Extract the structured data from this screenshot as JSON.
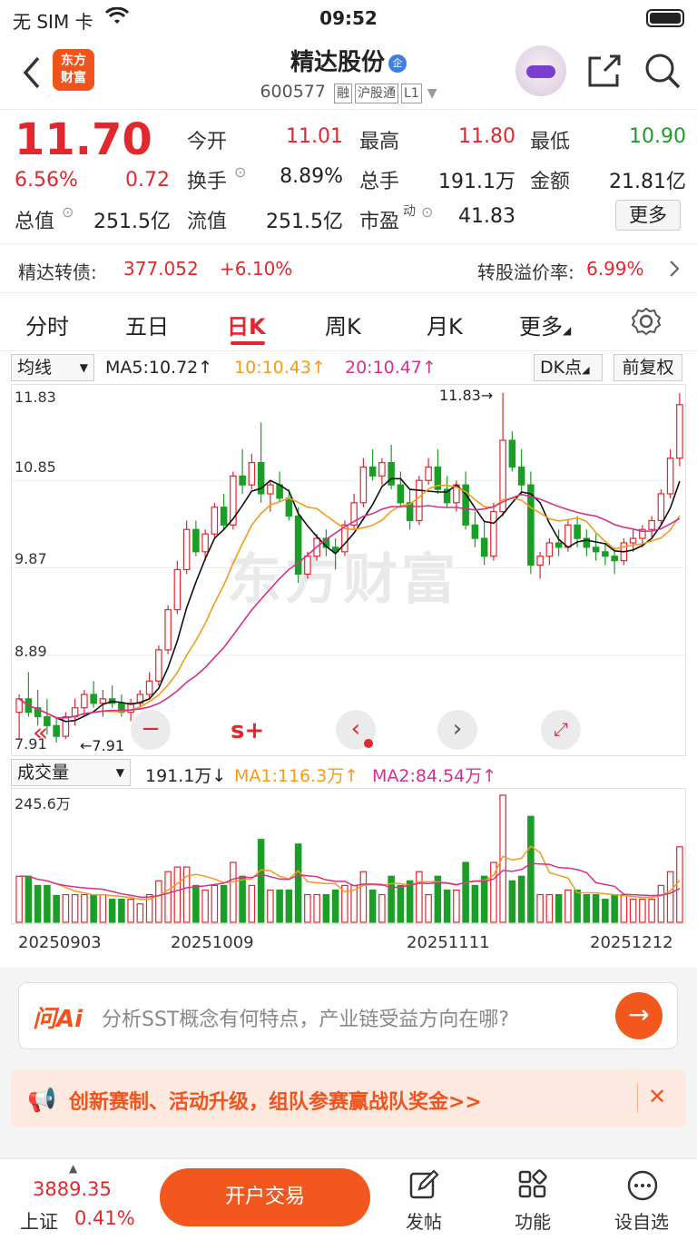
{
  "status_bar": {
    "carrier": "无 SIM 卡",
    "time": "09:52"
  },
  "header": {
    "logo_line1": "东方",
    "logo_line2": "财富",
    "stock_name": "精达股份",
    "badge": "企",
    "code": "600577",
    "tags": [
      "融",
      "沪股通",
      "L1"
    ]
  },
  "quote": {
    "price": "11.70",
    "change_pct": "6.56%",
    "change": "0.72",
    "open_label": "今开",
    "open": "11.01",
    "high_label": "最高",
    "high": "11.80",
    "low_label": "最低",
    "low": "10.90",
    "turnover_label": "换手",
    "turnover": "8.89%",
    "volume_label": "总手",
    "volume": "191.1万",
    "amount_label": "金额",
    "amount": "21.81亿",
    "mktcap_label": "总值",
    "mktcap": "251.5亿",
    "float_label": "流值",
    "float_cap": "251.5亿",
    "pe_label": "市盈",
    "pe_sup": "动",
    "pe": "41.83",
    "more": "更多"
  },
  "bond": {
    "label": "精达转债:",
    "price": "377.052",
    "pct": "+6.10%",
    "premium_label": "转股溢价率:",
    "premium": "6.99%"
  },
  "tabs": [
    "分时",
    "五日",
    "日K",
    "周K",
    "月K",
    "更多"
  ],
  "kline": {
    "ma_select": "均线",
    "ma5": "MA5:10.72↑",
    "ma10": "10:10.43↑",
    "ma20": "20:10.47↑",
    "dk": "DK点",
    "adjust": "前复权",
    "high_marker": "11.83→",
    "low_marker": "←7.91",
    "ticks": [
      "11.83",
      "10.85",
      "9.87",
      "8.89",
      "7.91"
    ],
    "watermark": "东方财富"
  },
  "volume": {
    "select": "成交量",
    "current": "191.1万↓",
    "ma1": "MA1:116.3万↑",
    "ma2": "MA2:84.54万↑",
    "max_label": "245.6万",
    "dates": [
      "20250903",
      "20251009",
      "20251111",
      "20251212"
    ]
  },
  "chart_data": {
    "type": "candlestick",
    "ylim": [
      7.91,
      11.83
    ],
    "ohlc": [
      [
        8.25,
        8.45,
        7.95,
        8.4
      ],
      [
        8.4,
        8.7,
        8.2,
        8.25
      ],
      [
        8.3,
        8.5,
        8.1,
        8.2
      ],
      [
        8.2,
        8.4,
        8.0,
        8.1
      ],
      [
        8.1,
        8.2,
        7.91,
        7.98
      ],
      [
        7.98,
        8.25,
        7.95,
        8.2
      ],
      [
        8.2,
        8.4,
        8.1,
        8.3
      ],
      [
        8.3,
        8.5,
        8.2,
        8.45
      ],
      [
        8.45,
        8.6,
        8.3,
        8.35
      ],
      [
        8.35,
        8.5,
        8.2,
        8.4
      ],
      [
        8.4,
        8.55,
        8.3,
        8.35
      ],
      [
        8.35,
        8.45,
        8.2,
        8.25
      ],
      [
        8.25,
        8.4,
        8.15,
        8.35
      ],
      [
        8.35,
        8.5,
        8.3,
        8.45
      ],
      [
        8.45,
        8.7,
        8.4,
        8.6
      ],
      [
        8.6,
        9.0,
        8.55,
        8.95
      ],
      [
        8.95,
        9.45,
        8.9,
        9.4
      ],
      [
        9.4,
        9.95,
        9.35,
        9.85
      ],
      [
        9.85,
        10.4,
        9.8,
        10.3
      ],
      [
        10.3,
        10.4,
        10.0,
        10.05
      ],
      [
        10.05,
        10.3,
        9.95,
        10.25
      ],
      [
        10.25,
        10.6,
        10.2,
        10.55
      ],
      [
        10.55,
        10.7,
        10.3,
        10.35
      ],
      [
        10.35,
        10.95,
        10.3,
        10.9
      ],
      [
        10.9,
        11.2,
        10.7,
        10.8
      ],
      [
        10.8,
        11.15,
        10.75,
        11.05
      ],
      [
        11.05,
        11.5,
        10.6,
        10.7
      ],
      [
        10.7,
        10.85,
        10.5,
        10.8
      ],
      [
        10.8,
        10.95,
        10.6,
        10.65
      ],
      [
        10.65,
        10.75,
        10.4,
        10.45
      ],
      [
        10.45,
        10.55,
        9.7,
        9.8
      ],
      [
        9.8,
        10.05,
        9.75,
        10.0
      ],
      [
        10.0,
        10.25,
        9.95,
        10.2
      ],
      [
        10.2,
        10.3,
        10.0,
        10.1
      ],
      [
        10.1,
        10.2,
        9.85,
        10.05
      ],
      [
        10.05,
        10.4,
        10.0,
        10.35
      ],
      [
        10.35,
        10.7,
        10.3,
        10.6
      ],
      [
        10.6,
        11.1,
        10.55,
        11.0
      ],
      [
        11.0,
        11.2,
        10.85,
        10.9
      ],
      [
        10.9,
        11.1,
        10.8,
        11.05
      ],
      [
        11.05,
        11.25,
        10.75,
        10.8
      ],
      [
        10.8,
        10.95,
        10.55,
        10.6
      ],
      [
        10.6,
        10.75,
        10.3,
        10.4
      ],
      [
        10.4,
        10.9,
        10.35,
        10.85
      ],
      [
        10.85,
        11.1,
        10.8,
        11.0
      ],
      [
        11.0,
        11.2,
        10.7,
        10.75
      ],
      [
        10.75,
        10.9,
        10.55,
        10.6
      ],
      [
        10.6,
        10.85,
        10.5,
        10.8
      ],
      [
        10.8,
        10.95,
        10.3,
        10.35
      ],
      [
        10.35,
        10.5,
        10.1,
        10.2
      ],
      [
        10.2,
        10.4,
        9.9,
        10.0
      ],
      [
        10.0,
        10.6,
        9.95,
        10.5
      ],
      [
        10.5,
        11.83,
        10.45,
        11.3
      ],
      [
        11.3,
        11.4,
        10.95,
        11.0
      ],
      [
        11.0,
        11.2,
        10.7,
        10.8
      ],
      [
        10.8,
        10.95,
        9.8,
        9.9
      ],
      [
        9.9,
        10.05,
        9.75,
        10.0
      ],
      [
        10.0,
        10.2,
        9.9,
        10.15
      ],
      [
        10.15,
        10.3,
        10.0,
        10.1
      ],
      [
        10.1,
        10.4,
        10.05,
        10.35
      ],
      [
        10.35,
        10.45,
        10.1,
        10.2
      ],
      [
        10.2,
        10.3,
        10.0,
        10.1
      ],
      [
        10.1,
        10.25,
        9.95,
        10.05
      ],
      [
        10.05,
        10.15,
        9.9,
        10.0
      ],
      [
        10.0,
        10.1,
        9.8,
        9.95
      ],
      [
        9.95,
        10.2,
        9.9,
        10.15
      ],
      [
        10.15,
        10.3,
        10.05,
        10.2
      ],
      [
        10.2,
        10.35,
        10.1,
        10.3
      ],
      [
        10.3,
        10.45,
        10.2,
        10.4
      ],
      [
        10.4,
        10.75,
        10.35,
        10.7
      ],
      [
        10.7,
        11.2,
        10.65,
        11.1
      ],
      [
        11.1,
        11.83,
        11.01,
        11.7
      ]
    ]
  },
  "ai": {
    "logo": "问Ai",
    "prompt": "分析SST概念有何特点，产业链受益方向在哪?"
  },
  "promo": {
    "text": "创新赛制、活动升级，组队参赛赢战队奖金>>"
  },
  "bottom": {
    "index_value": "3889.35",
    "index_name": "上证",
    "index_pct": "0.41%",
    "trade": "开户交易",
    "post": "发帖",
    "function": "功能",
    "watch": "设自选"
  }
}
